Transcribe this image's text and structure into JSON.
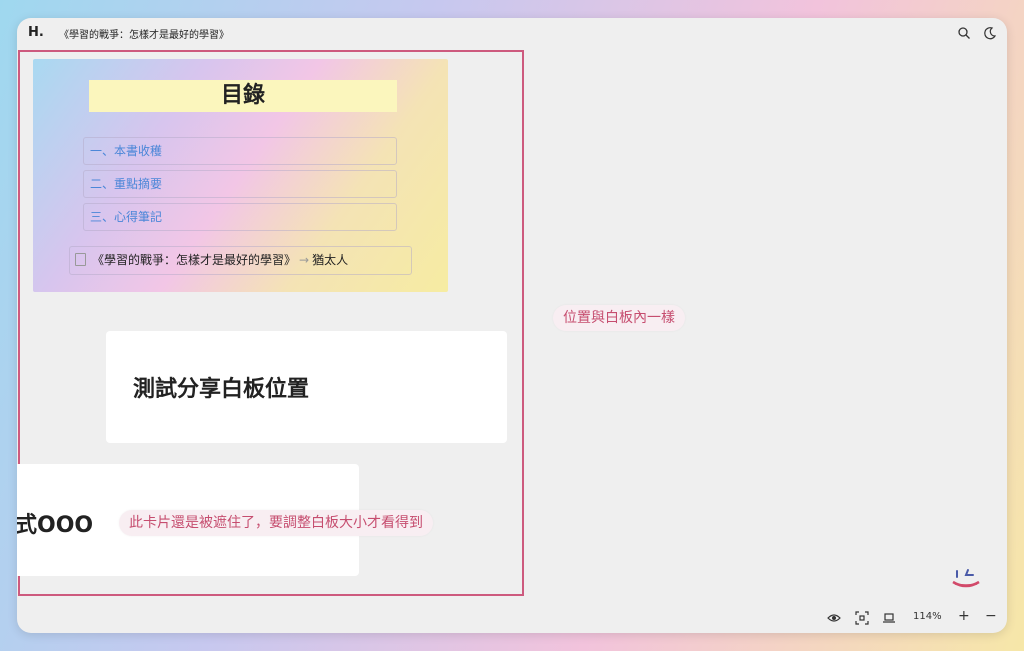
{
  "app": {
    "logo": "H.",
    "title": "《學習的戰爭：怎樣才是最好的學習》"
  },
  "toolbar": {
    "icons": [
      "search-icon",
      "moon-icon"
    ]
  },
  "toc": {
    "title": "目錄",
    "items": [
      {
        "label": "一、本書收穫"
      },
      {
        "label": "二、重點摘要"
      },
      {
        "label": "三、心得筆記"
      }
    ],
    "book_link": {
      "title": "《學習的戰爭：怎樣才是最好的學習》",
      "arrow": "→",
      "author": "猶太人"
    }
  },
  "cards": {
    "test": "測試分享白板位置",
    "hidden": "式OOO"
  },
  "annotations": {
    "position_note": "位置與白板內一樣",
    "hidden_note": "此卡片還是被遮住了，要調整白板大小才看得到"
  },
  "bottom": {
    "zoom": "114%",
    "zoom_in": "+",
    "zoom_out": "−",
    "icons": [
      "eye-icon",
      "fit-screen-icon",
      "laptop-icon"
    ]
  },
  "colors": {
    "frame": "#cd5a7e",
    "link": "#4a86d8",
    "note": "#c64d6f"
  }
}
